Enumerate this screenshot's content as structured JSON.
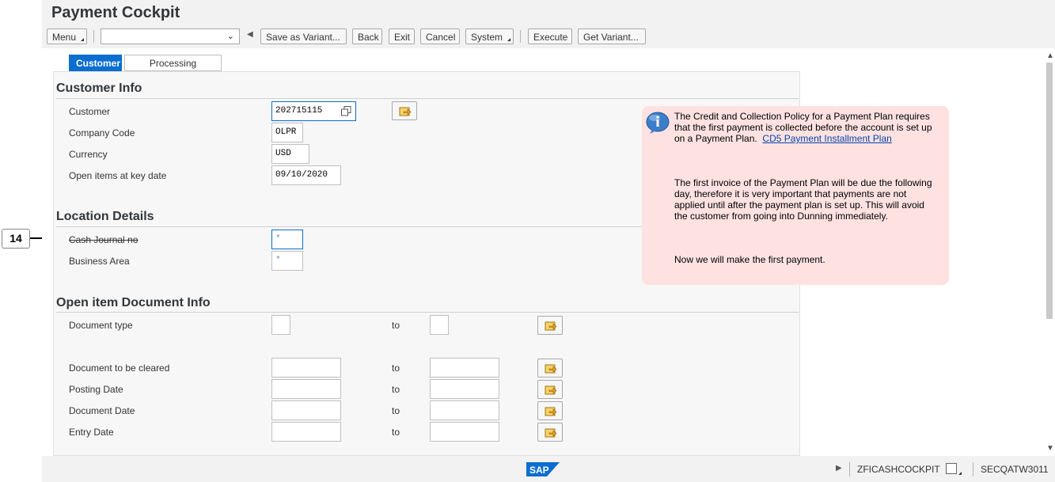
{
  "page": {
    "title": "Payment Cockpit"
  },
  "toolbar": {
    "menu_label": "Menu",
    "command_value": "",
    "save_as_variant": "Save as Variant...",
    "back": "Back",
    "exit": "Exit",
    "cancel": "Cancel",
    "system": "System",
    "execute": "Execute",
    "get_variant": "Get Variant..."
  },
  "tabs": [
    {
      "label": "Customer",
      "selected": true
    },
    {
      "label": "Processing Controls",
      "selected": false
    }
  ],
  "sections": {
    "customer_info": {
      "title": "Customer Info",
      "customer_label": "Customer",
      "customer_value": "202715115",
      "company_code_label": "Company Code",
      "company_code_value": "OLPR",
      "currency_label": "Currency",
      "currency_value": "USD",
      "open_items_label": "Open items at key date",
      "open_items_value": "09/10/2020"
    },
    "location_details": {
      "title": "Location Details",
      "cash_journal_label": "Cash Journal  no",
      "cash_journal_value": "*",
      "business_area_label": "Business Area",
      "business_area_value": "*"
    },
    "open_item_doc": {
      "title": "Open item Document Info",
      "to_label": "to",
      "rows": [
        {
          "label": "Document type",
          "from": "",
          "to": ""
        },
        {
          "label": "Document to be cleared",
          "from": "",
          "to": ""
        },
        {
          "label": "Posting Date",
          "from": "",
          "to": ""
        },
        {
          "label": "Document Date",
          "from": "",
          "to": ""
        },
        {
          "label": "Entry Date",
          "from": "",
          "to": ""
        }
      ]
    }
  },
  "info_bubble": {
    "p1_text": "The Credit and Collection Policy for a Payment Plan requires that the first payment is collected before the account is set up on a Payment Plan.",
    "p1_link": "CD5 Payment Installment Plan",
    "p2": "The first invoice of the Payment Plan will be due the following day, therefore it is very important that payments are not applied until after the payment plan is set up. This will avoid the customer from going into Dunning immediately.",
    "p3": "Now we will make the first payment."
  },
  "callout": {
    "number": "14"
  },
  "statusbar": {
    "transaction": "ZFICASHCOCKPIT",
    "system": "SECQATW3011",
    "logo_text": "SAP"
  },
  "icons": {
    "multiple_selection": "multiple-selection-icon",
    "value_help": "value-help-icon",
    "info": "info-icon"
  },
  "colors": {
    "accent": "#0a6ed1",
    "info_bg": "#fde2e1",
    "link": "#0645ad"
  }
}
